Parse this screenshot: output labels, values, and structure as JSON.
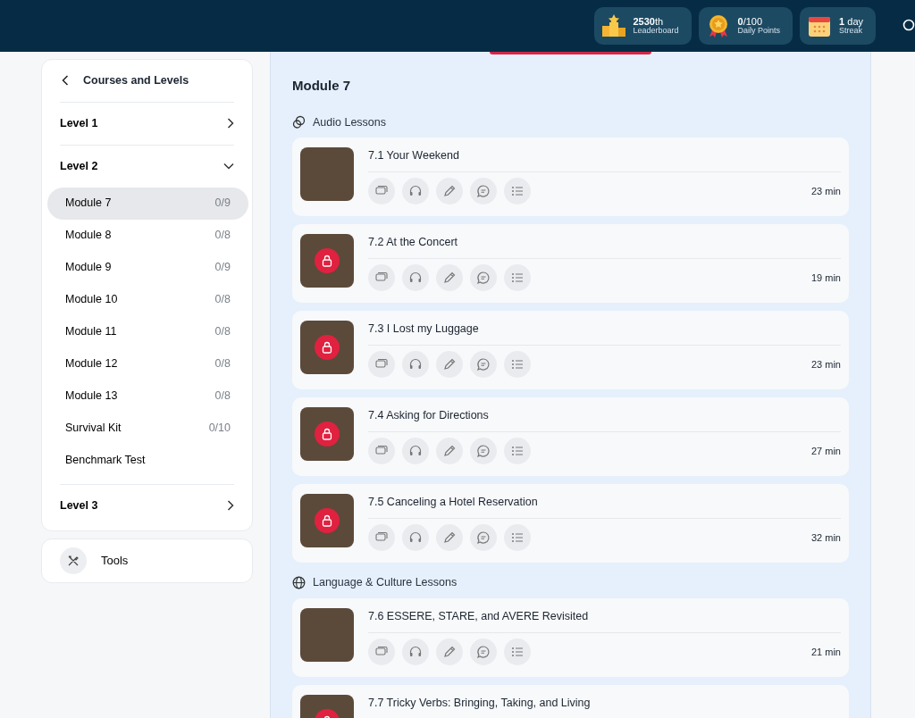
{
  "header": {
    "stats": [
      {
        "kind": "leaderboard",
        "value": "**2530**th",
        "label": "Leaderboard"
      },
      {
        "kind": "points",
        "value": "**0**/100",
        "label": "Daily Points"
      },
      {
        "kind": "streak",
        "value": "**1** day",
        "label": "Streak"
      }
    ]
  },
  "sidebar": {
    "title": "Courses and Levels",
    "levels": [
      {
        "label": "Level 1",
        "expanded": false
      },
      {
        "label": "Level 2",
        "expanded": true,
        "children": [
          {
            "label": "Module 7",
            "progress": "0/9",
            "selected": true
          },
          {
            "label": "Module 8",
            "progress": "0/8",
            "selected": false
          },
          {
            "label": "Module 9",
            "progress": "0/9",
            "selected": false
          },
          {
            "label": "Module 10",
            "progress": "0/8",
            "selected": false
          },
          {
            "label": "Module 11",
            "progress": "0/8",
            "selected": false
          },
          {
            "label": "Module 12",
            "progress": "0/8",
            "selected": false
          },
          {
            "label": "Module 13",
            "progress": "0/8",
            "selected": false
          },
          {
            "label": "Survival Kit",
            "progress": "0/10",
            "selected": false
          },
          {
            "label": "Benchmark Test",
            "selected": false
          }
        ]
      },
      {
        "label": "Level 3",
        "expanded": false
      }
    ],
    "tools": {
      "label": "Tools"
    }
  },
  "main": {
    "title": "Module 7",
    "sections": [
      {
        "kind": "audio",
        "title": "Audio Lessons",
        "lessons": [
          {
            "title": "7.1 Your Weekend",
            "duration": "23 min",
            "locked": false
          },
          {
            "title": "7.2 At the Concert",
            "duration": "19 min",
            "locked": true
          },
          {
            "title": "7.3 I Lost my Luggage",
            "duration": "23 min",
            "locked": true
          },
          {
            "title": "7.4 Asking for Directions",
            "duration": "27 min",
            "locked": true
          },
          {
            "title": "7.5 Canceling a Hotel Reservation",
            "duration": "32 min",
            "locked": true
          }
        ]
      },
      {
        "kind": "culture",
        "title": "Language & Culture Lessons",
        "lessons": [
          {
            "title": "7.6 ESSERE, STARE, and AVERE Revisited",
            "duration": "21 min",
            "locked": false
          },
          {
            "title": "7.7 Tricky Verbs: Bringing, Taking, and Living",
            "locked": true
          }
        ]
      }
    ]
  }
}
